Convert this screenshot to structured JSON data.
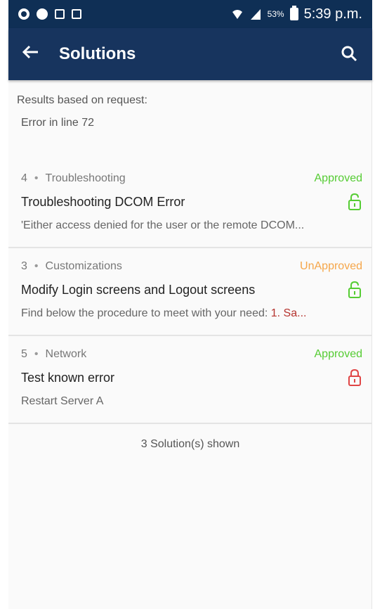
{
  "status_bar": {
    "battery": "53%",
    "time": "5:39 p.m."
  },
  "app_bar": {
    "title": "Solutions",
    "back_icon": "arrow-left-icon",
    "search_icon": "search-icon"
  },
  "request": {
    "label": "Results based on request:",
    "value": "Error in line 72"
  },
  "solutions": [
    {
      "id": "4",
      "category": "Troubleshooting",
      "status": "Approved",
      "title": "Troubleshooting DCOM Error",
      "summary": "'Either access denied for the user or the remote DCOM...",
      "lock_color": "#55cc33"
    },
    {
      "id": "3",
      "category": "Customizations",
      "status": "UnApproved",
      "title": "Modify Login screens and Logout screens",
      "summary": "Find below the procedure to meet with your need: ",
      "summary_highlight": "1. Sa...",
      "lock_color": "#55cc33"
    },
    {
      "id": "5",
      "category": "Network",
      "status": "Approved",
      "title": "Test known error",
      "summary": "Restart Server A",
      "lock_color": "#e04545"
    }
  ],
  "footer": {
    "count_text": "3 Solution(s) shown"
  },
  "colors": {
    "approved": "#55cc33",
    "unapproved": "#f5a64a",
    "app_bar": "#17345e"
  }
}
